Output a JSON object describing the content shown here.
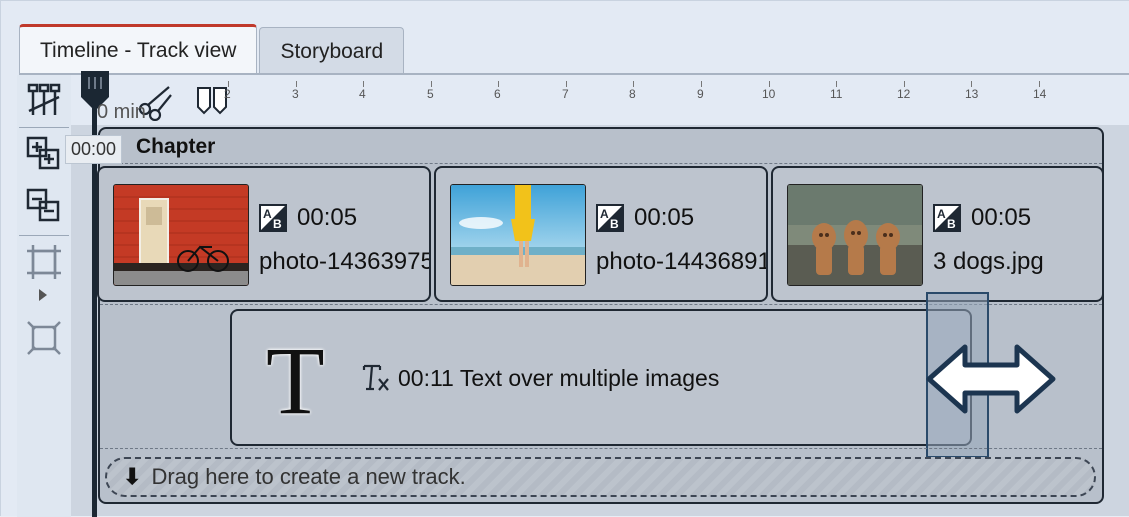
{
  "tabs": [
    {
      "label": "Timeline - Track view",
      "active": true
    },
    {
      "label": "Storyboard",
      "active": false
    }
  ],
  "ruler": {
    "unit_label": "0 min",
    "ticks": [
      "2",
      "3",
      "4",
      "5",
      "6",
      "7",
      "8",
      "9",
      "10",
      "11",
      "12",
      "13",
      "14"
    ]
  },
  "playhead": {
    "time": "00:00"
  },
  "chapter": {
    "title": "Chapter"
  },
  "clips": [
    {
      "duration": "00:05",
      "name": "photo-14363975",
      "icon": "image-effect-icon"
    },
    {
      "duration": "00:05",
      "name": "photo-14436891",
      "icon": "image-effect-icon"
    },
    {
      "duration": "00:05",
      "name": "3 dogs.jpg",
      "icon": "image-effect-icon"
    }
  ],
  "text_clip": {
    "label": "00:11 Text over multiple images",
    "big_letter": "T"
  },
  "dropzone": {
    "label": "Drag here to create a new track."
  },
  "colors": {
    "accent_tab": "#c0392b",
    "playhead": "#1b2733",
    "handle_border": "#2a4a6a"
  }
}
